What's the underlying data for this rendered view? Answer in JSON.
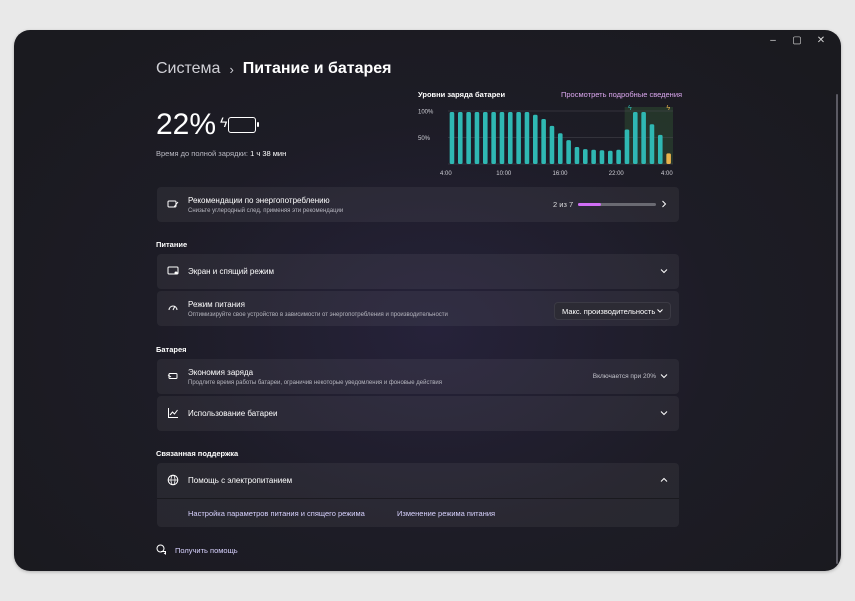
{
  "window": {
    "minimize": "–",
    "maximize": "▢",
    "close": "✕"
  },
  "breadcrumb": {
    "parent": "Система",
    "separator": "›",
    "current": "Питание и батарея"
  },
  "battery": {
    "percent": "22%",
    "charge_label": "Время до полной зарядки:",
    "charge_value": "1 ч 38 мин"
  },
  "chart": {
    "title": "Уровни заряда батареи",
    "link": "Просмотреть подробные сведения"
  },
  "chart_data": {
    "type": "bar",
    "title": "Уровни заряда батареи",
    "x_ticks": [
      "4:00",
      "10:00",
      "16:00",
      "22:00",
      "4:00"
    ],
    "y_ticks": [
      "100%",
      "50%"
    ],
    "ylim": [
      0,
      100
    ],
    "values": [
      98,
      98,
      98,
      98,
      98,
      98,
      98,
      98,
      98,
      98,
      93,
      85,
      72,
      58,
      45,
      32,
      28,
      27,
      26,
      25,
      27,
      65,
      98,
      98,
      75,
      55,
      20
    ],
    "colors": {
      "normal": "#2fb8b3",
      "charging": "#e8b34d",
      "highlight_bg": "#2d4a32",
      "grid": "#4a4a52"
    },
    "markers": [
      "charging-bolt",
      "charging-bolt"
    ]
  },
  "recommendations": {
    "title": "Рекомендации по энергопотреблению",
    "subtitle": "Снизьте углеродный след, применяя эти рекомендации",
    "progress_text": "2 из 7",
    "progress": 0.29
  },
  "sections": {
    "power": "Питание",
    "battery": "Батарея",
    "support": "Связанная поддержка"
  },
  "screen_sleep": {
    "title": "Экран и спящий режим"
  },
  "power_mode": {
    "title": "Режим питания",
    "subtitle": "Оптимизируйте свое устройство в зависимости от энергопотребления и производительности",
    "value": "Макс. производительность"
  },
  "battery_saver": {
    "title": "Экономия заряда",
    "subtitle": "Продлите время работы батареи, ограничив некоторые уведомления и фоновые действия",
    "status": "Включается при 20%"
  },
  "battery_usage": {
    "title": "Использование батареи"
  },
  "power_help": {
    "title": "Помощь с электропитанием",
    "link1": "Настройка параметров питания и спящего режима",
    "link2": "Изменение режима питания"
  },
  "get_help": "Получить помощь"
}
